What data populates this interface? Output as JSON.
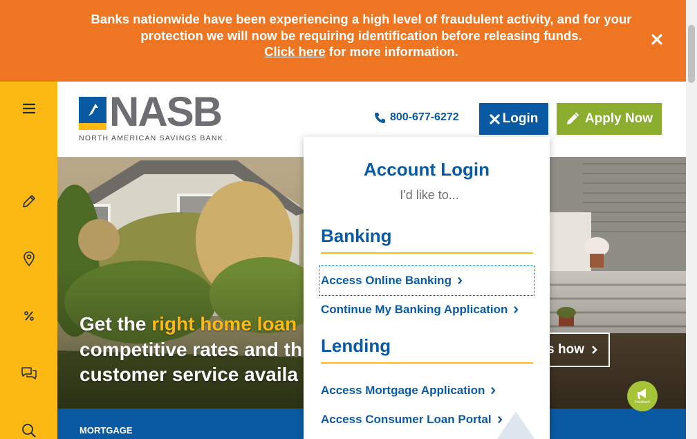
{
  "alert": {
    "line1": "Banks nationwide have been experiencing a high level of fraudulent activity, and for your",
    "line2": "protection we will now be requiring identification before releasing funds.",
    "link_text": "Click here",
    "line3_suffix": " for more information.",
    "close_icon": "close-icon",
    "bg_color": "#ee7521"
  },
  "rail": {
    "bg_color": "#fcb813",
    "icons": [
      "menu-icon",
      "pencil-icon",
      "location-pin-icon",
      "percent-icon",
      "chat-icon",
      "search-icon"
    ]
  },
  "header": {
    "logo_word": "NASB",
    "logo_tagline": "NORTH AMERICAN SAVINGS BANK",
    "phone": "800-677-6272",
    "login_label": "Login",
    "apply_label": "Apply Now"
  },
  "hero": {
    "line1_prefix": "Get the ",
    "line1_highlight": "right home loan",
    "line2": "competitive rates and th",
    "line3": "customer service availa",
    "cta_partial": "s how"
  },
  "strip": {
    "label": "MORTGAGE"
  },
  "feedback": {
    "label": "Feedback"
  },
  "panel": {
    "title": "Account Login",
    "subtitle": "I'd like to...",
    "banking_heading": "Banking",
    "banking_links": [
      "Access Online Banking",
      "Continue My Banking Application"
    ],
    "lending_heading": "Lending",
    "lending_links": [
      "Access Mortgage Application",
      "Access Consumer Loan Portal"
    ]
  },
  "colors": {
    "brand_blue": "#0a5aa3",
    "brand_yellow": "#fcb813",
    "apply_green": "#8cad2d",
    "alert_orange": "#ee7521"
  }
}
